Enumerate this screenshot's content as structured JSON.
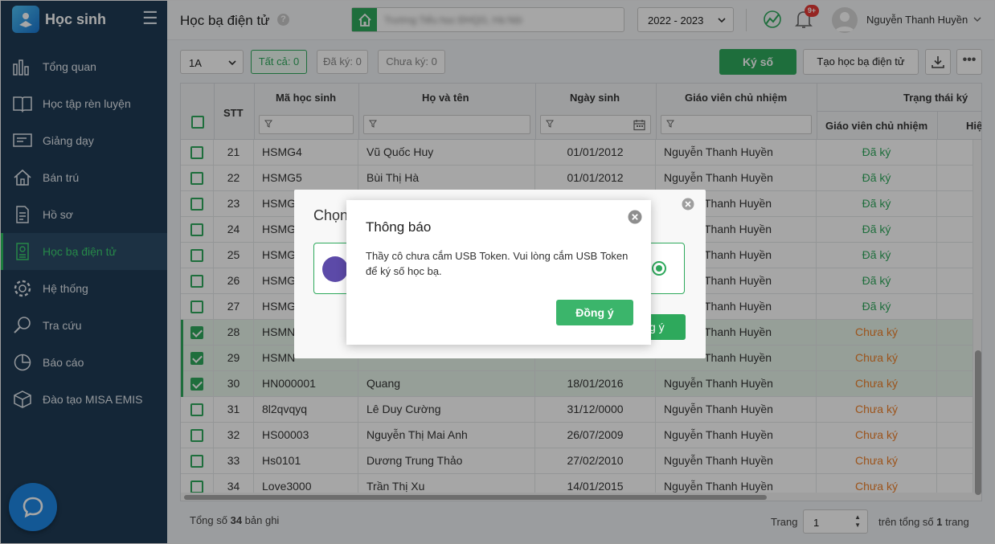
{
  "sidebar": {
    "app_title": "Học sinh",
    "items": [
      {
        "label": "Tổng quan",
        "icon": "bar-chart-icon"
      },
      {
        "label": "Học tập rèn luyện",
        "icon": "book-icon"
      },
      {
        "label": "Giảng dạy",
        "icon": "board-icon"
      },
      {
        "label": "Bán trú",
        "icon": "home-icon"
      },
      {
        "label": "Hồ sơ",
        "icon": "document-icon"
      },
      {
        "label": "Học bạ điện tử",
        "icon": "certificate-icon",
        "active": true
      },
      {
        "label": "Hệ thống",
        "icon": "gear-icon"
      },
      {
        "label": "Tra cứu",
        "icon": "search-icon"
      },
      {
        "label": "Báo cáo",
        "icon": "pie-chart-icon"
      },
      {
        "label": "Đào tạo MISA EMIS",
        "icon": "box-icon"
      }
    ]
  },
  "header": {
    "title": "Học bạ điện tử",
    "help": "?",
    "year": "2022 - 2023",
    "notification_badge": "9+",
    "user_name": "Nguyễn Thanh Huyền"
  },
  "toolbar": {
    "class": "1A",
    "tab_all": "Tất cả: 0",
    "tab_signed": "Đã ký: 0",
    "tab_unsigned": "Chưa ký: 0",
    "sign_button": "Ký số",
    "create_button": "Tạo học bạ điện tử",
    "more": "•••"
  },
  "table": {
    "headers": {
      "stt": "STT",
      "student_id": "Mã học sinh",
      "name": "Họ và tên",
      "dob": "Ngày sinh",
      "teacher": "Giáo viên chủ nhiệm",
      "status": "Trạng thái ký",
      "status_teacher": "Giáo viên chủ nhiệm",
      "status_principal": "Hiệ"
    },
    "rows": [
      {
        "stt": "21",
        "id": "HSMG4",
        "name": "Vũ Quốc Huy",
        "dob": "01/01/2012",
        "teacher": "Nguyễn Thanh Huyền",
        "status": "Đã ký",
        "selected": false
      },
      {
        "stt": "22",
        "id": "HSMG5",
        "name": "Bùi Thị Hà",
        "dob": "01/01/2012",
        "teacher": "Nguyễn Thanh Huyền",
        "status": "Đã ký",
        "selected": false
      },
      {
        "stt": "23",
        "id": "HSMG(",
        "name": "",
        "dob": "",
        "teacher": "Thanh Huyền",
        "status": "Đã ký",
        "selected": false
      },
      {
        "stt": "24",
        "id": "HSMG",
        "name": "",
        "dob": "",
        "teacher": "Thanh Huyền",
        "status": "Đã ký",
        "selected": false
      },
      {
        "stt": "25",
        "id": "HSMG",
        "name": "",
        "dob": "",
        "teacher": "Thanh Huyền",
        "status": "Đã ký",
        "selected": false
      },
      {
        "stt": "26",
        "id": "HSMG'",
        "name": "",
        "dob": "",
        "teacher": "Thanh Huyền",
        "status": "Đã ký",
        "selected": false
      },
      {
        "stt": "27",
        "id": "HSMG",
        "name": "",
        "dob": "",
        "teacher": "Thanh Huyền",
        "status": "Đã ký",
        "selected": false
      },
      {
        "stt": "28",
        "id": "HSMN",
        "name": "",
        "dob": "",
        "teacher": "Thanh Huyền",
        "status": "Chưa ký",
        "selected": true
      },
      {
        "stt": "29",
        "id": "HSMN",
        "name": "",
        "dob": "",
        "teacher": "Thanh Huyền",
        "status": "Chưa ký",
        "selected": true
      },
      {
        "stt": "30",
        "id": "HN000001",
        "name": "Quang",
        "dob": "18/01/2016",
        "teacher": "Nguyễn Thanh Huyền",
        "status": "Chưa ký",
        "selected": true
      },
      {
        "stt": "31",
        "id": "8l2qvqyq",
        "name": "Lê Duy Cường",
        "dob": "31/12/0000",
        "teacher": "Nguyễn Thanh Huyền",
        "status": "Chưa ký",
        "selected": false
      },
      {
        "stt": "32",
        "id": "HS00003",
        "name": "Nguyễn Thị Mai Anh",
        "dob": "26/07/2009",
        "teacher": "Nguyễn Thanh Huyền",
        "status": "Chưa ký",
        "selected": false
      },
      {
        "stt": "33",
        "id": "Hs0101",
        "name": "Dương Trung Thảo",
        "dob": "27/02/2010",
        "teacher": "Nguyễn Thanh Huyền",
        "status": "Chưa ký",
        "selected": false
      },
      {
        "stt": "34",
        "id": "Love3000",
        "name": "Trần Thị Xu",
        "dob": "14/01/2015",
        "teacher": "Nguyễn Thanh Huyền",
        "status": "Chưa ký",
        "selected": false
      }
    ]
  },
  "footer": {
    "total_prefix": "Tổng số ",
    "total_count": "34",
    "total_suffix": " bản ghi",
    "page_label": "Trang",
    "page_value": "1",
    "page_total_prefix": "trên tổng số ",
    "page_total": "1",
    "page_total_suffix": " trang"
  },
  "under_dialog": {
    "title": "Chọn",
    "button": "g ý"
  },
  "dialog": {
    "title": "Thông báo",
    "message": "Thầy cô chưa cắm USB Token. Vui lòng cắm USB Token để ký số học bạ.",
    "ok_button": "Đồng ý"
  },
  "colors": {
    "sidebar": "#1f3b55",
    "accent": "#2ea95c",
    "signed": "#2ea95c",
    "unsigned": "#f0812a"
  }
}
